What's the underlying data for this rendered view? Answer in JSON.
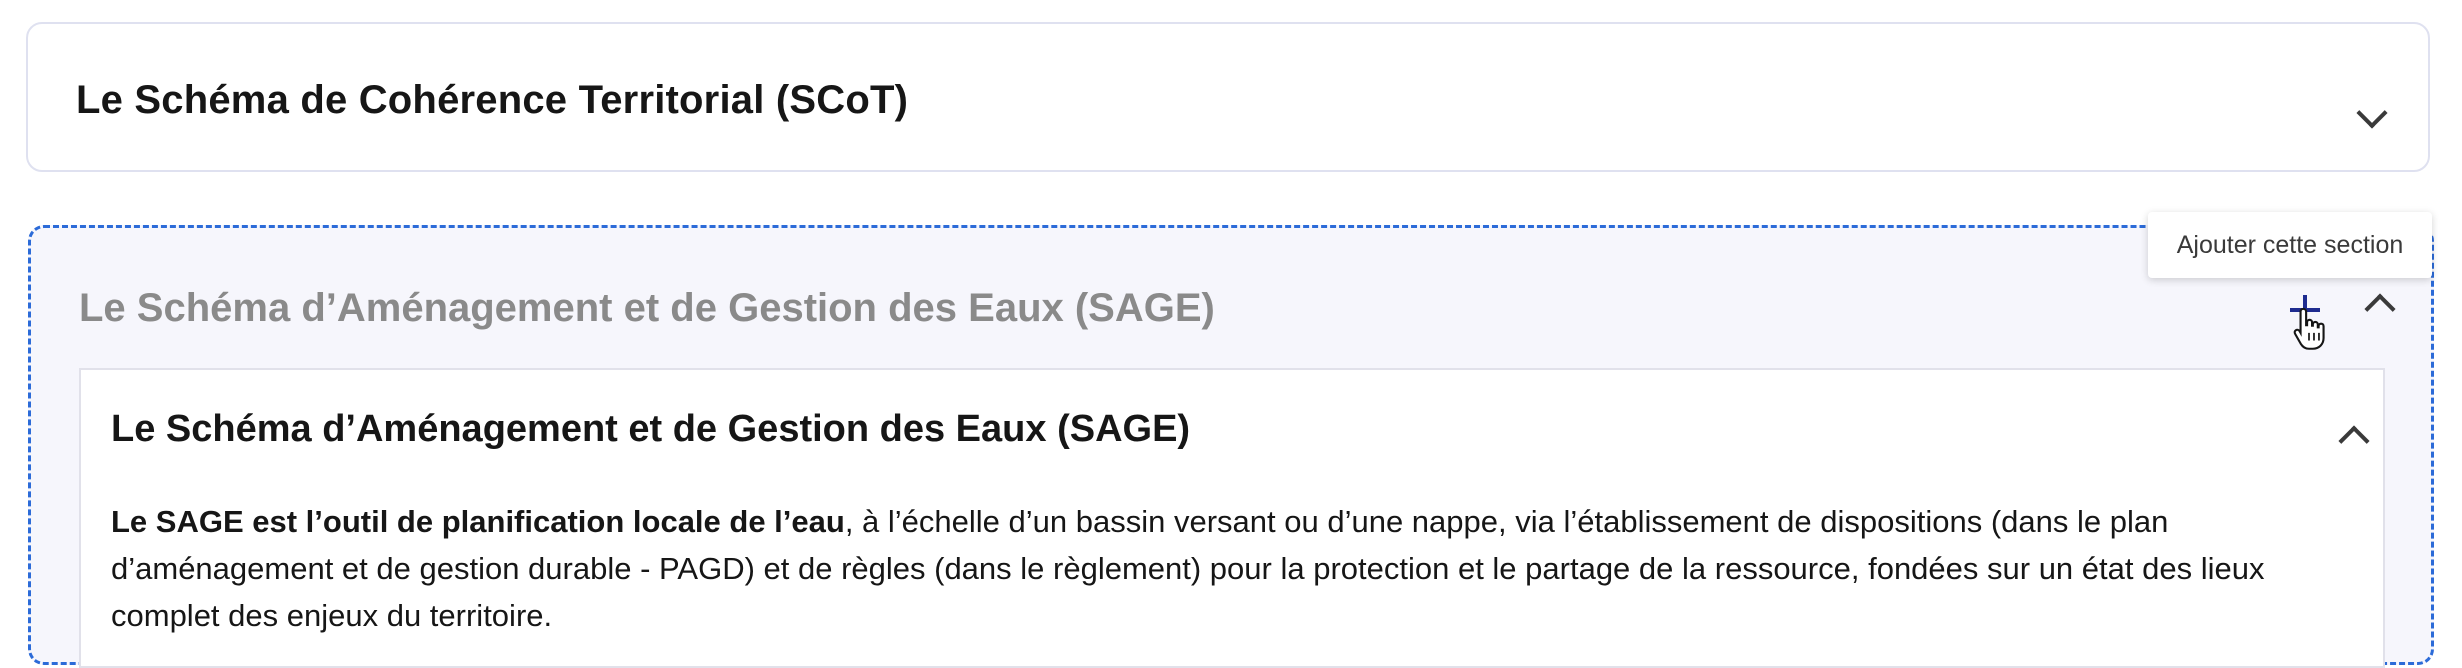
{
  "sections": {
    "scot": {
      "title": "Le Schéma de Cohérence Territorial (SCoT)",
      "state": "collapsed"
    },
    "sage": {
      "title": "Le Schéma d’Aménagement et de Gestion des Eaux (SAGE)",
      "state": "expanded",
      "add_tooltip": "Ajouter cette section",
      "inner": {
        "title": "Le Schéma d’Aménagement et de Gestion des Eaux (SAGE)",
        "body_bold": "Le SAGE est l’outil de planification locale de l’eau",
        "body_rest": ", à l’échelle d’un bassin versant ou d’une nappe, via l’établissement de dispositions (dans le plan d’aménagement et de gestion durable - PAGD) et de règles (dans le règlement) pour la protection et le partage de la ressource, fondées sur un état des lieux complet des enjeux du territoire."
      }
    }
  },
  "colors": {
    "dashed_border": "#2c6bd8",
    "add_icon": "#1e2b8f",
    "disabled_title": "#8a8a8a"
  },
  "icons": [
    "chevron-down-icon",
    "chevron-up-icon",
    "plus-icon",
    "hand-pointer-cursor-icon"
  ]
}
